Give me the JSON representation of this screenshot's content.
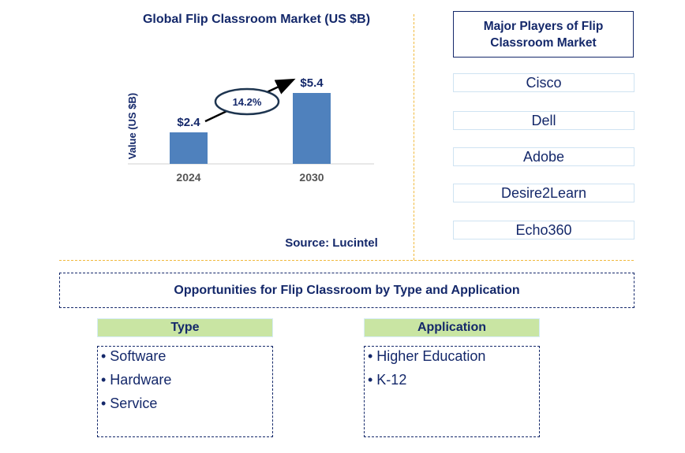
{
  "chart_data": {
    "type": "bar",
    "title": "Global Flip Classroom Market (US $B)",
    "categories": [
      "2024",
      "2030"
    ],
    "values": [
      2.4,
      5.4
    ],
    "data_labels": [
      "$2.4",
      "$5.4"
    ],
    "ylabel": "Value (US $B)",
    "xlabel": "",
    "ylim": [
      0,
      5.4
    ],
    "grid": false,
    "annotation": "14.2%",
    "bar_color": "#4f81bd"
  },
  "source": "Source: Lucintel",
  "players": {
    "title": "Major Players of Flip Classroom Market",
    "items": [
      "Cisco",
      "Dell",
      "Adobe",
      "Desire2Learn",
      "Echo360"
    ]
  },
  "opportunities": {
    "title": "Opportunities for Flip Classroom by Type and Application",
    "categories": [
      {
        "label": "Type",
        "items": [
          "Software",
          "Hardware",
          "Service"
        ]
      },
      {
        "label": "Application",
        "items": [
          "Higher Education",
          "K-12"
        ]
      }
    ]
  },
  "colors": {
    "text": "#14286a",
    "divider": "#f0b93c",
    "category_header": "#c9e5a3"
  }
}
